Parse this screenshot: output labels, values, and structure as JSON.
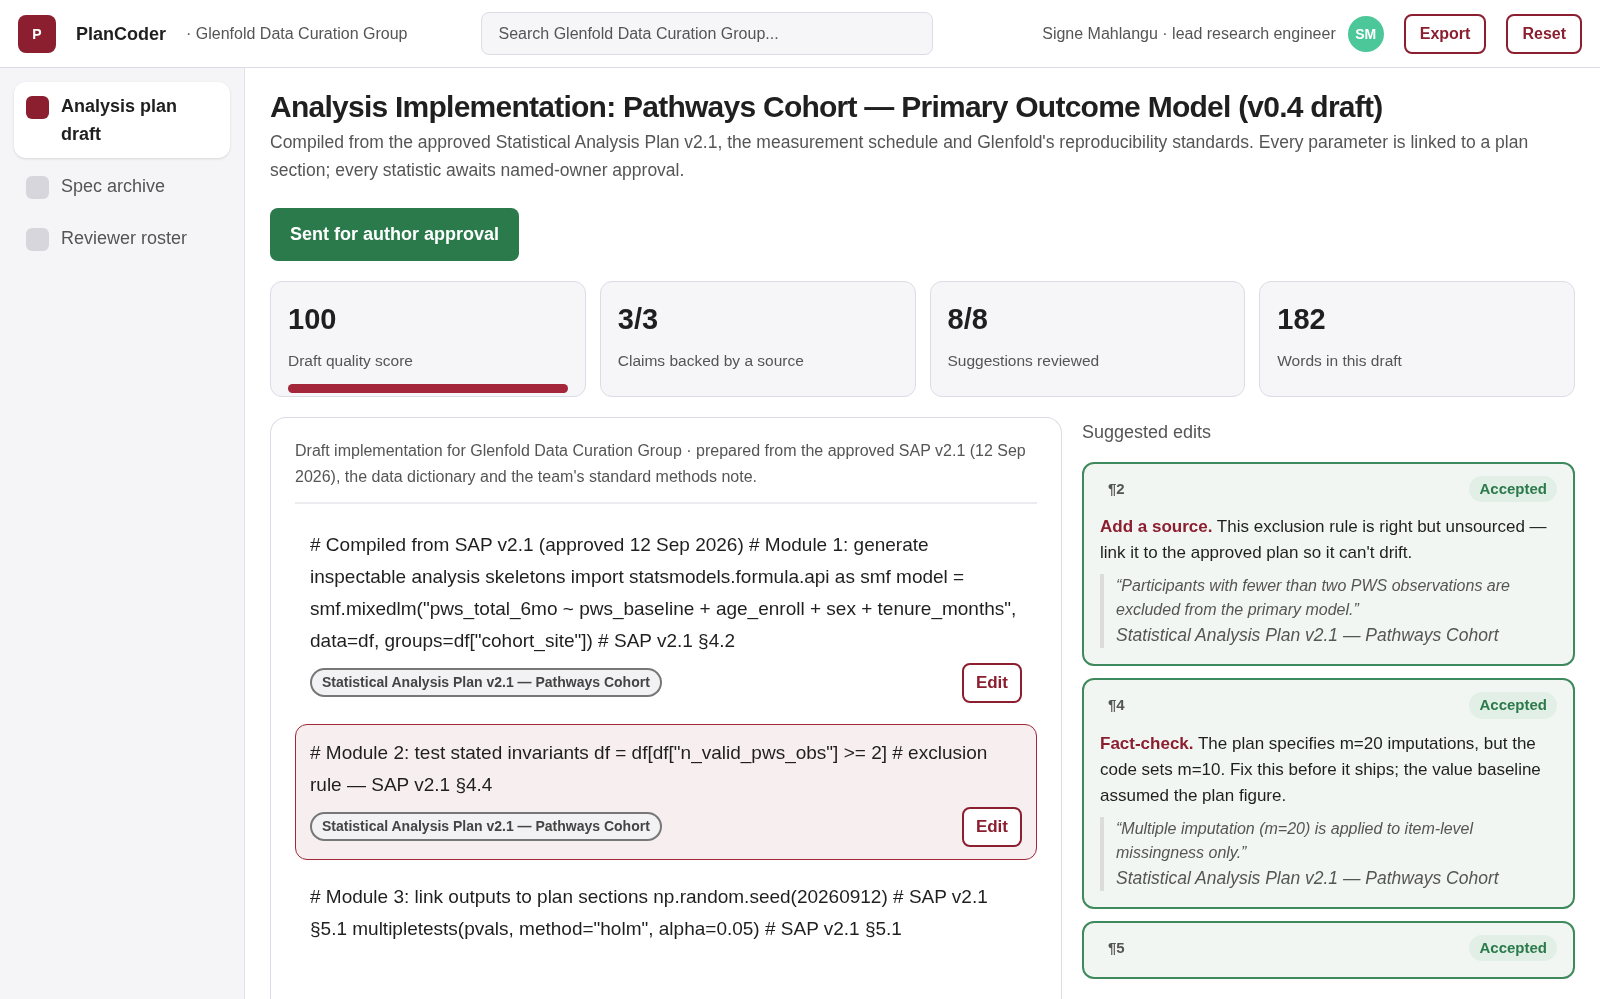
{
  "app": {
    "logo": "P",
    "name": "PlanCoder",
    "workspace": "· Glenfold Data Curation Group"
  },
  "search": {
    "placeholder": "Search Glenfold Data Curation Group..."
  },
  "user": {
    "label": "Signe Mahlangu · lead research engineer",
    "initials": "SM"
  },
  "header_buttons": [
    "Export",
    "Reset"
  ],
  "sidebar": {
    "items": [
      {
        "label": "Analysis plan draft",
        "selected": true
      },
      {
        "label": "Spec archive",
        "selected": false
      },
      {
        "label": "Reviewer roster",
        "selected": false
      }
    ]
  },
  "page": {
    "title": "Analysis Implementation: Pathways Cohort — Primary Outcome Model (v0.4 draft)",
    "subtitle": "Compiled from the approved Statistical Analysis Plan v2.1, the measurement schedule and Glenfold's reproducibility standards. Every parameter is linked to a plan section; every statistic awaits named-owner approval.",
    "status_button": "Sent for author approval"
  },
  "stats": [
    {
      "value": "100",
      "label": "Draft quality score",
      "level": 1.0
    },
    {
      "value": "3/3",
      "label": "Claims backed by a source"
    },
    {
      "value": "8/8",
      "label": "Suggestions reviewed"
    },
    {
      "value": "182",
      "label": "Words in this draft"
    }
  ],
  "draft": {
    "intro": "Draft implementation for Glenfold Data Curation Group · prepared from the approved SAP v2.1 (12 Sep 2026), the data dictionary and the team's standard methods note.",
    "blocks": [
      {
        "code": "# Compiled from SAP v2.1 (approved 12 Sep 2026) # Module 1: generate inspectable analysis skeletons import statsmodels.formula.api as smf model = smf.mixedlm(\"pws_total_6mo ~ pws_baseline + age_enroll + sex + tenure_months\", data=df, groups=df[\"cohort_site\"]) # SAP v2.1 §4.2",
        "source": "Statistical Analysis Plan v2.1 — Pathways Cohort",
        "action": "Edit",
        "selected": false
      },
      {
        "code": "# Module 2: test stated invariants df = df[df[\"n_valid_pws_obs\"] >= 2] # exclusion rule — SAP v2.1 §4.4",
        "source": "Statistical Analysis Plan v2.1 — Pathways Cohort",
        "action": "Edit",
        "selected": true
      },
      {
        "code": "# Module 3: link outputs to plan sections np.random.seed(20260912) # SAP v2.1 §5.1 multipletests(pvals, method=\"holm\", alpha=0.05) # SAP v2.1 §5.1",
        "selected": false
      }
    ]
  },
  "suggestions": {
    "title": "Suggested edits",
    "items": [
      {
        "paragraph": "¶2",
        "status": "Accepted",
        "text": "**Add a source.** This exclusion rule is right but unsourced — link it to the approved plan so it can't drift.",
        "quote": "“Participants with fewer than two PWS observations are excluded from the primary model.”",
        "source": "Statistical Analysis Plan v2.1 — Pathways Cohort"
      },
      {
        "paragraph": "¶4",
        "status": "Accepted",
        "text": "**Fact-check.** The plan specifies m=20 imputations, but the code sets m=10. Fix this before it ships; the value baseline assumed the plan figure.",
        "quote": "“Multiple imputation (m=20) is applied to item-level missingness only.”",
        "source": "Statistical Analysis Plan v2.1 — Pathways Cohort"
      },
      {
        "paragraph": "¶5",
        "status": "Accepted"
      }
    ]
  }
}
